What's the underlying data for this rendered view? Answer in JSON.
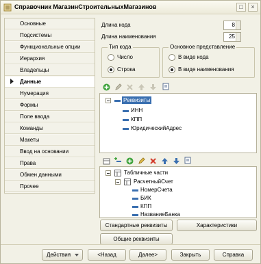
{
  "window": {
    "title": "Справочник МагазинСтроительныхМагазинов"
  },
  "sidebar": {
    "items": [
      {
        "label": "Основные",
        "active": false
      },
      {
        "label": "Подсистемы",
        "active": false
      },
      {
        "label": "Функциональные опции",
        "active": false
      },
      {
        "label": "Иерархия",
        "active": false
      },
      {
        "label": "Владельцы",
        "active": false
      },
      {
        "label": "Данные",
        "active": true
      },
      {
        "label": "Нумерация",
        "active": false
      },
      {
        "label": "Формы",
        "active": false
      },
      {
        "label": "Поле ввода",
        "active": false
      },
      {
        "label": "Команды",
        "active": false
      },
      {
        "label": "Макеты",
        "active": false
      },
      {
        "label": "Ввод на основании",
        "active": false
      },
      {
        "label": "Права",
        "active": false
      },
      {
        "label": "Обмен данными",
        "active": false
      },
      {
        "label": "Прочее",
        "active": false
      }
    ]
  },
  "form": {
    "code_length_label": "Длина кода",
    "code_length_value": "8",
    "name_length_label": "Длина наименования",
    "name_length_value": "25",
    "code_type": {
      "title": "Тип кода",
      "options": [
        "Число",
        "Строка"
      ],
      "selected": "Строка"
    },
    "main_view": {
      "title": "Основное представление",
      "options": [
        "В виде кода",
        "В виде наименования"
      ],
      "selected": "В виде наименования"
    }
  },
  "attributes_tree": {
    "root": "Реквизиты",
    "children": [
      "ИНН",
      "КПП",
      "ЮридическийАдрес"
    ]
  },
  "tabular_tree": {
    "root": "Табличные части",
    "section": "РасчетныйСчет",
    "children": [
      "НомерСчета",
      "БИК",
      "КПП",
      "НазваниеБанка"
    ]
  },
  "buttons": {
    "standard_attributes": "Стандартные реквизиты",
    "characteristics": "Характеристики",
    "common_attributes": "Общие реквизиты"
  },
  "footer": {
    "actions": "Действия",
    "back": "<Назад",
    "next": "Далее>",
    "close": "Закрыть",
    "help": "Справка"
  },
  "colors": {
    "accent_blue": "#3a6fb0",
    "window_bg": "#f2f1e6"
  }
}
